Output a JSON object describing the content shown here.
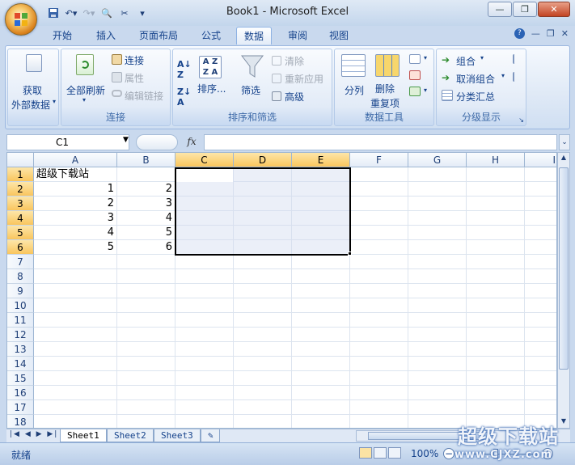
{
  "window": {
    "title": "Book1 - Microsoft Excel"
  },
  "tabs": [
    "开始",
    "插入",
    "页面布局",
    "公式",
    "数据",
    "审阅",
    "视图"
  ],
  "active_tab": "数据",
  "groups": {
    "external": {
      "btn": "获取",
      "btn2": "外部数据"
    },
    "connections": {
      "refresh": "全部刷新",
      "link": "连接",
      "props": "属性",
      "edit_links": "编辑链接",
      "label": "连接"
    },
    "sort_filter": {
      "sort": "排序...",
      "filter": "筛选",
      "clear": "清除",
      "reapply": "重新应用",
      "advanced": "高级",
      "label": "排序和筛选"
    },
    "data_tools": {
      "split": "分列",
      "remove_dup1": "删除",
      "remove_dup2": "重复项",
      "label": "数据工具"
    },
    "outline": {
      "group": "组合",
      "ungroup": "取消组合",
      "subtotal": "分类汇总",
      "label": "分级显示"
    }
  },
  "namebox": {
    "value": "C1"
  },
  "formula": {
    "fx": "fx",
    "value": ""
  },
  "columns": [
    "A",
    "B",
    "C",
    "D",
    "E",
    "F",
    "G",
    "H",
    "I"
  ],
  "rows": [
    "1",
    "2",
    "3",
    "4",
    "5",
    "6",
    "7",
    "8",
    "9",
    "10",
    "11",
    "12",
    "13",
    "14",
    "15",
    "16",
    "17",
    "18"
  ],
  "cells": {
    "A1": "超级下载站",
    "A2": "1",
    "B2": "2",
    "A3": "2",
    "B3": "3",
    "A4": "3",
    "B4": "4",
    "A5": "4",
    "B5": "5",
    "A6": "5",
    "B6": "6"
  },
  "sheets": [
    "Sheet1",
    "Sheet2",
    "Sheet3"
  ],
  "active_sheet": "Sheet1",
  "status": {
    "ready": "就绪",
    "zoom": "100%"
  },
  "watermark": {
    "line1": "超级下载站",
    "line2": "www.CJXZ.com"
  }
}
